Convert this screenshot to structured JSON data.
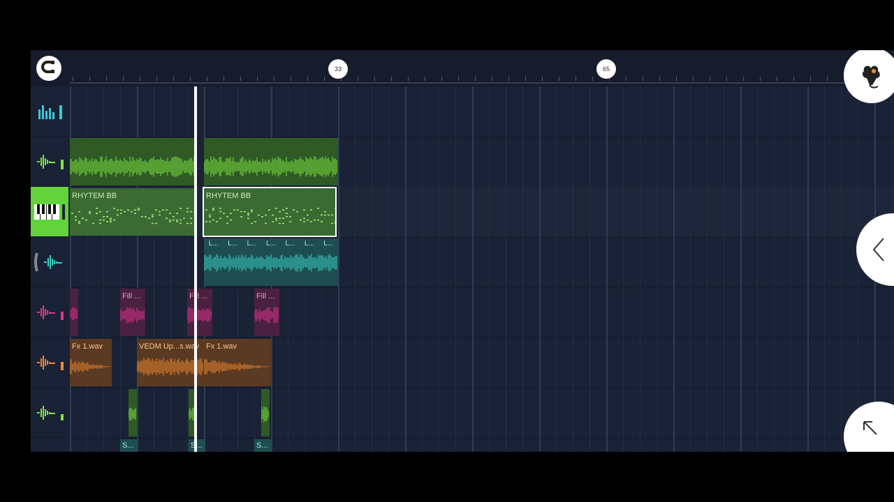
{
  "ruler": {
    "markers": [
      "33",
      "65"
    ]
  },
  "tracks": [
    {
      "icon": "instrument-icon",
      "color": "#3fc7d8",
      "clips": []
    },
    {
      "icon": "waveform-icon",
      "color": "#7ce640",
      "clips": [
        {
          "label": ""
        },
        {
          "label": ""
        }
      ]
    },
    {
      "icon": "piano-keys-icon",
      "color": "#62d33a",
      "selected": true,
      "clips": [
        {
          "label": "RHYTEM BB"
        },
        {
          "label": "RHYTEM BB"
        }
      ]
    },
    {
      "icon": "waveform-icon",
      "color": "#37d1c0",
      "clips": [
        {
          "label": "L...",
          "labels": [
            "L...",
            "L...",
            "L...",
            "L...",
            "L...",
            "L...",
            "L..."
          ]
        }
      ]
    },
    {
      "icon": "waveform-icon",
      "color": "#e2338f",
      "clips": [
        {
          "label": ""
        },
        {
          "label": "Fill ..."
        },
        {
          "label": "Fill ..."
        },
        {
          "label": "Fill ..."
        }
      ]
    },
    {
      "icon": "waveform-icon",
      "color": "#f08a2d",
      "clips": [
        {
          "label": "Fx 1.wav"
        },
        {
          "label": "VEDM Up...s.wav"
        },
        {
          "label": "Fx 1.wav"
        }
      ]
    },
    {
      "icon": "waveform-icon",
      "color": "#7ce640",
      "clips": [
        {
          "label": ""
        },
        {
          "label": ""
        },
        {
          "label": ""
        }
      ]
    },
    {
      "icon": "waveform-icon",
      "color": "#37d1c0",
      "clips": [
        {
          "label": "S..."
        },
        {
          "label": "S..."
        },
        {
          "label": "S..."
        }
      ]
    }
  ],
  "buttons": {
    "snap": "magnet-icon",
    "logo": "fruit-logo-icon",
    "collapse": "chevron-left-icon",
    "expand": "arrow-up-left-icon"
  }
}
